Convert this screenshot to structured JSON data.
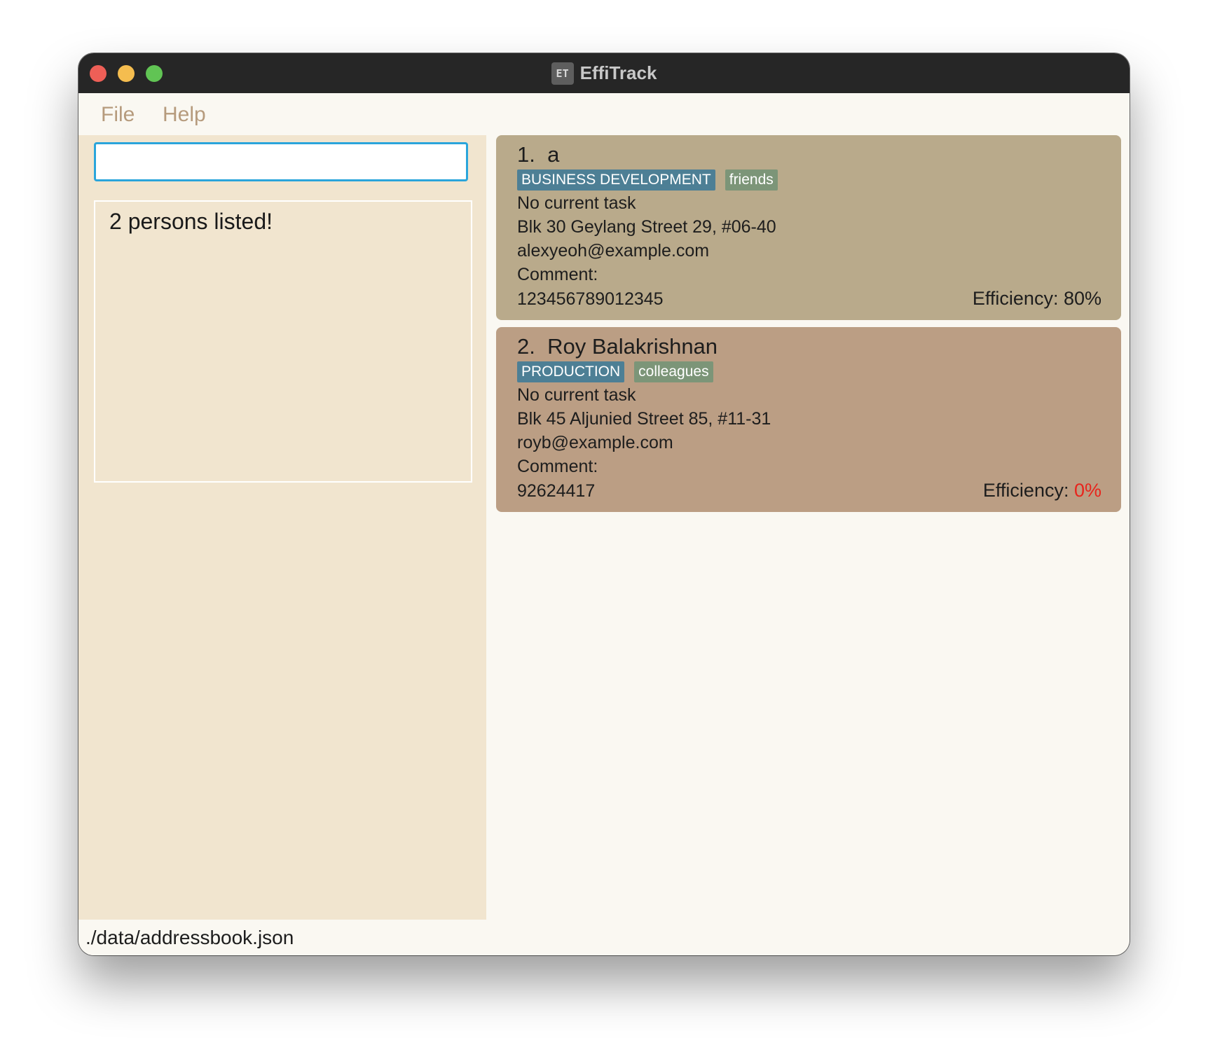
{
  "window": {
    "title": "EffiTrack",
    "app_icon_text": "ET"
  },
  "menu": {
    "file": "File",
    "help": "Help"
  },
  "command_box": {
    "value": ""
  },
  "result_display": {
    "text": "2 persons listed!"
  },
  "persons": [
    {
      "name": "1.  a",
      "department": "BUSINESS DEVELOPMENT",
      "tag": "friends",
      "task": "No current task",
      "address": "Blk 30 Geylang Street 29, #06-40",
      "email": "alexyeoh@example.com",
      "comment_label": "Comment:",
      "phone": "123456789012345",
      "efficiency_label": "Efficiency: ",
      "efficiency_value": "80%",
      "background": "#b9aa8b"
    },
    {
      "name": "2.  Roy Balakrishnan",
      "department": "PRODUCTION",
      "tag": "colleagues",
      "task": "No current task",
      "address": "Blk 45 Aljunied Street 85, #11-31",
      "email": "royb@example.com",
      "comment_label": "Comment:",
      "phone": "92624417",
      "efficiency_label": "Efficiency: ",
      "efficiency_value": "0%",
      "background": "#bb9e84",
      "efficiency_color": "#e8241c"
    }
  ],
  "status_bar": {
    "path": "./data/addressbook.json"
  },
  "colors": {
    "titlebar": "#262626",
    "menu_text": "#b69b7d",
    "left_panel": "#f1e5cf",
    "input_border": "#2aa5db",
    "department_tag": "#4d7f95",
    "label_tag": "#7c9578"
  }
}
